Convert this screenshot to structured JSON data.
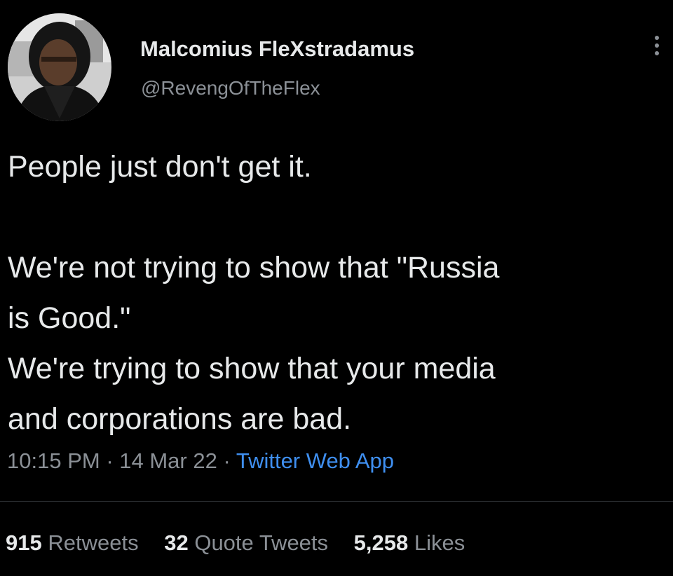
{
  "tweet": {
    "author": {
      "display_name": "Malcomius FleXstradamus",
      "handle": "@RevengOfTheFlex",
      "avatar_icon": "profile-photo"
    },
    "more_icon": "ellipsis-vertical-icon",
    "text": {
      "line1": "People just don't get it.",
      "line2": "We're not trying to show that \"Russia",
      "line3": "is Good.\"",
      "line4": "We're trying to show that your media",
      "line5": "and corporations are bad."
    },
    "meta": {
      "time": "10:15 PM",
      "separator1": " · ",
      "date": "14 Mar 22",
      "separator2": " · ",
      "source": "Twitter Web App"
    },
    "stats": {
      "retweets_count": "915",
      "retweets_label": "Retweets",
      "quotes_count": "32",
      "quotes_label": "Quote Tweets",
      "likes_count": "5,258",
      "likes_label": "Likes"
    }
  },
  "colors": {
    "background": "#000000",
    "primary_text": "#e7e9ea",
    "secondary_text": "#8b9096",
    "link": "#3f8ff0",
    "divider": "#2a2d31"
  }
}
